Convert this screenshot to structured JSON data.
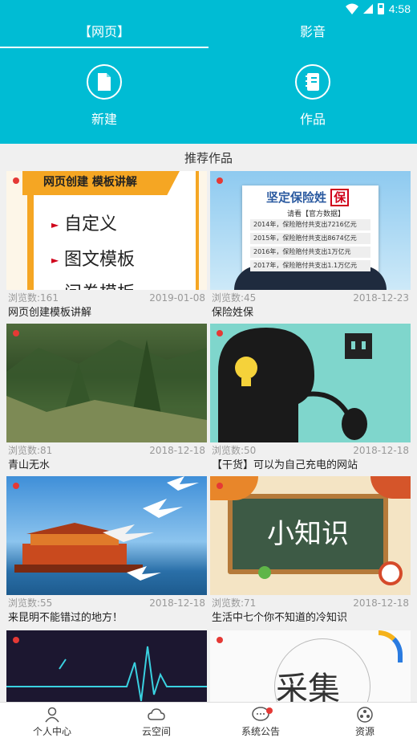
{
  "status": {
    "time": "4:58"
  },
  "tabs": [
    {
      "label": "【网页】"
    },
    {
      "label": "影音"
    }
  ],
  "actions": [
    {
      "label": "新建"
    },
    {
      "label": "作品"
    }
  ],
  "section_title": "推荐作品",
  "cards": [
    {
      "views": "浏览数:161",
      "date": "2019-01-08",
      "title": "网页创建模板讲解",
      "thumb": {
        "heading": "网页创建 模板讲解",
        "lines": [
          "自定义",
          "图文模板",
          "问卷模板"
        ]
      }
    },
    {
      "views": "浏览数:45",
      "date": "2018-12-23",
      "title": "保险姓保",
      "thumb": {
        "heading": "坚定保险姓",
        "badge": "保",
        "sub": "请看【官方数据】",
        "lines": [
          "2014年，保险赔付共支出7216亿元",
          "2015年，保险赔付共支出8674亿元",
          "2016年，保险赔付共支出1万亿元",
          "2017年，保险赔付共支出1.1万亿元"
        ]
      }
    },
    {
      "views": "浏览数:81",
      "date": "2018-12-18",
      "title": "青山无水"
    },
    {
      "views": "浏览数:50",
      "date": "2018-12-18",
      "title": "【干货】可以为自己充电的网站"
    },
    {
      "views": "浏览数:55",
      "date": "2018-12-18",
      "title": "来昆明不能错过的地方！"
    },
    {
      "views": "浏览数:71",
      "date": "2018-12-18",
      "title": "生活中七个你不知道的冷知识",
      "thumb": {
        "board": "小知识"
      }
    },
    {
      "thumb": {}
    },
    {
      "thumb": {
        "text": "采集"
      }
    }
  ],
  "bottom_nav": [
    {
      "label": "个人中心",
      "icon": "person-icon"
    },
    {
      "label": "云空间",
      "icon": "cloud-icon"
    },
    {
      "label": "系统公告",
      "icon": "chat-icon",
      "badge": true
    },
    {
      "label": "资源",
      "icon": "resource-icon"
    }
  ],
  "colors": {
    "primary": "#00bcd4",
    "badge": "#e53935"
  }
}
